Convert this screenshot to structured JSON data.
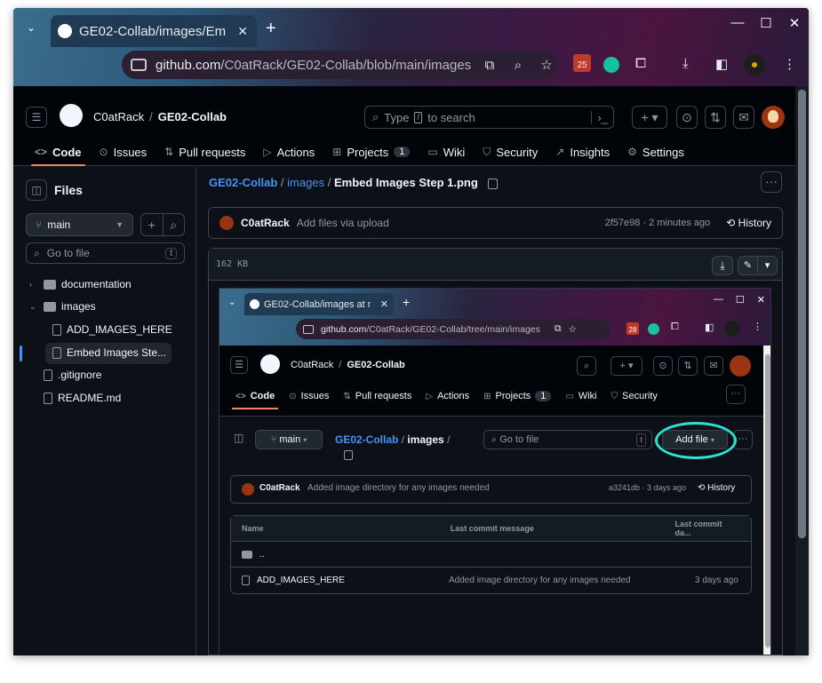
{
  "browser": {
    "tab_title": "GE02-Collab/images/Em",
    "url_host": "github.com",
    "url_path": "/C0atRack/GE02-Collab/blob/main/images...",
    "ext_badge": "25"
  },
  "header": {
    "owner": "C0atRack",
    "repo": "GE02-Collab",
    "search_prefix": "Type",
    "search_key": "/",
    "search_suffix": "to search"
  },
  "nav": {
    "tabs": [
      {
        "label": "Code",
        "icon": "<>"
      },
      {
        "label": "Issues",
        "icon": "⊙"
      },
      {
        "label": "Pull requests",
        "icon": "⇅"
      },
      {
        "label": "Actions",
        "icon": "▷"
      },
      {
        "label": "Projects",
        "icon": "⊞",
        "count": "1"
      },
      {
        "label": "Wiki",
        "icon": "▭"
      },
      {
        "label": "Security",
        "icon": "⛉"
      },
      {
        "label": "Insights",
        "icon": "↗"
      },
      {
        "label": "Settings",
        "icon": "⚙"
      }
    ]
  },
  "sidebar": {
    "title": "Files",
    "branch": "main",
    "goto_placeholder": "Go to file",
    "goto_key": "t",
    "tree": [
      {
        "label": "documentation",
        "type": "folder"
      },
      {
        "label": "images",
        "type": "folder"
      },
      {
        "label": "ADD_IMAGES_HERE",
        "type": "file"
      },
      {
        "label": "Embed Images Ste...",
        "type": "file"
      },
      {
        "label": ".gitignore",
        "type": "file"
      },
      {
        "label": "README.md",
        "type": "file"
      }
    ]
  },
  "main": {
    "crumb_repo": "GE02-Collab",
    "crumb_sep": "/",
    "crumb_folder": "images",
    "crumb_file": "Embed Images Step 1.png",
    "commit_author": "C0atRack",
    "commit_message": "Add files via upload",
    "commit_sha_time": "2f57e98 · 2 minutes ago",
    "history_label": "History",
    "file_size": "162 KB"
  },
  "shot": {
    "tab_title": "GE02-Collab/images at m",
    "url_host": "github.com",
    "url_path": "/C0atRack/GE02-Collab/tree/main/images",
    "ext_badge": "28",
    "owner": "C0atRack",
    "repo": "GE02-Collab",
    "nav": [
      "Code",
      "Issues",
      "Pull requests",
      "Actions",
      "Projects",
      "Wiki",
      "Security"
    ],
    "projects_count": "1",
    "branch": "main",
    "crumb_repo": "GE02-Collab",
    "crumb_folder": "images",
    "goto_placeholder": "Go to file",
    "goto_key": "t",
    "add_file": "Add file",
    "commit_author": "C0atRack",
    "commit_message": "Added image directory for any images needed",
    "commit_sha_time": "a3241db · 3 days ago",
    "history_label": "History",
    "table_head": [
      "Name",
      "Last commit message",
      "Last commit da..."
    ],
    "parent_dir": "..",
    "rows": [
      {
        "name": "ADD_IMAGES_HERE",
        "message": "Added image directory for any images needed",
        "date": "3 days ago"
      }
    ]
  }
}
